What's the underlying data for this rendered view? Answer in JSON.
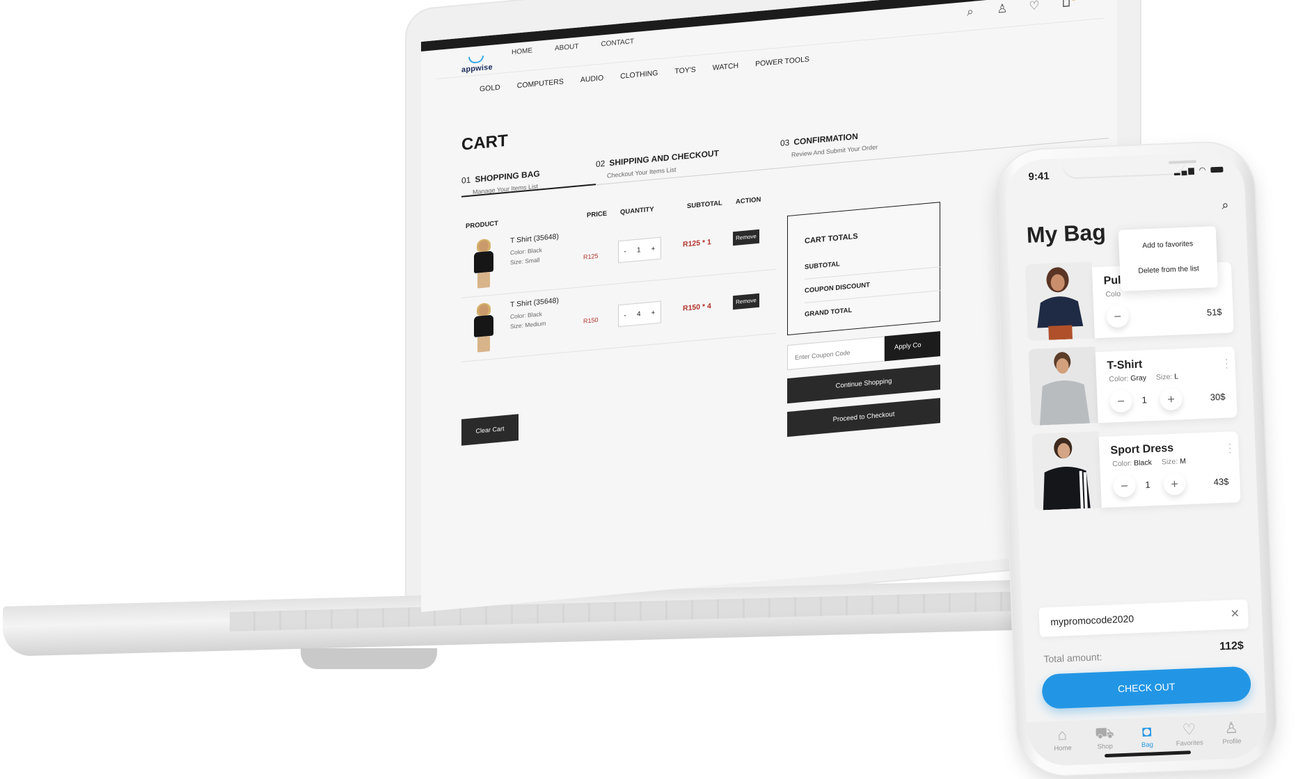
{
  "desktop": {
    "logo_text": "appwise",
    "top_nav": [
      "HOME",
      "ABOUT",
      "CONTACT"
    ],
    "categories": [
      "GOLD",
      "COMPUTERS",
      "AUDIO",
      "CLOTHING",
      "TOY'S",
      "WATCH",
      "POWER TOOLS"
    ],
    "cart_count": "0",
    "title": "CART",
    "steps": [
      {
        "num": "01",
        "title": "SHOPPING BAG",
        "subtitle": "Manage Your Items List"
      },
      {
        "num": "02",
        "title": "SHIPPING AND CHECKOUT",
        "subtitle": "Checkout Your Items List"
      },
      {
        "num": "03",
        "title": "CONFIRMATION",
        "subtitle": "Review And Submit Your Order"
      }
    ],
    "table": {
      "headers": [
        "PRODUCT",
        "PRICE",
        "QUANTITY",
        "SUBTOTAL",
        "ACTION"
      ],
      "rows": [
        {
          "name": "T Shirt (35648)",
          "color": "Color: Black",
          "size": "Size: Small",
          "price": "R125",
          "qty": "1",
          "subtotal": "R125 * 1",
          "action": "Remove"
        },
        {
          "name": "T Shirt (35648)",
          "color": "Color: Black",
          "size": "Size: Medium",
          "price": "R150",
          "qty": "4",
          "subtotal": "R150 * 4",
          "action": "Remove"
        }
      ],
      "qty_minus": "-",
      "qty_plus": "+"
    },
    "clear_cart": "Clear Cart",
    "totals": {
      "title": "CART TOTALS",
      "subtotal": "SUBTOTAL",
      "coupon_discount": "COUPON DISCOUNT",
      "grand_total": "GRAND TOTAL"
    },
    "coupon_placeholder": "Enter Coupon Code",
    "apply_label": "Apply Co",
    "continue_shopping": "Continue Shopping",
    "proceed_checkout": "Proceed to Checkout"
  },
  "mobile": {
    "time": "9:41",
    "title": "My Bag",
    "items": [
      {
        "name": "Pul",
        "color_label": "Colo",
        "price": "51$"
      },
      {
        "name": "T-Shirt",
        "color_label": "Color:",
        "color": "Gray",
        "size_label": "Size:",
        "size": "L",
        "qty": "1",
        "price": "30$"
      },
      {
        "name": "Sport Dress",
        "color_label": "Color:",
        "color": "Black",
        "size_label": "Size:",
        "size": "M",
        "qty": "1",
        "price": "43$"
      }
    ],
    "menu": {
      "add_favorites": "Add to favorites",
      "delete": "Delete from the list"
    },
    "promo_code": "mypromocode2020",
    "total_label": "Total amount:",
    "total_value": "112$",
    "checkout": "CHECK OUT",
    "tabs": [
      {
        "label": "Home",
        "icon": "home-icon"
      },
      {
        "label": "Shop",
        "icon": "cart-icon"
      },
      {
        "label": "Bag",
        "icon": "bag-icon"
      },
      {
        "label": "Favorites",
        "icon": "heart-icon"
      },
      {
        "label": "Profile",
        "icon": "profile-icon"
      }
    ],
    "active_tab": "Bag",
    "accent_color": "#2296e5"
  }
}
